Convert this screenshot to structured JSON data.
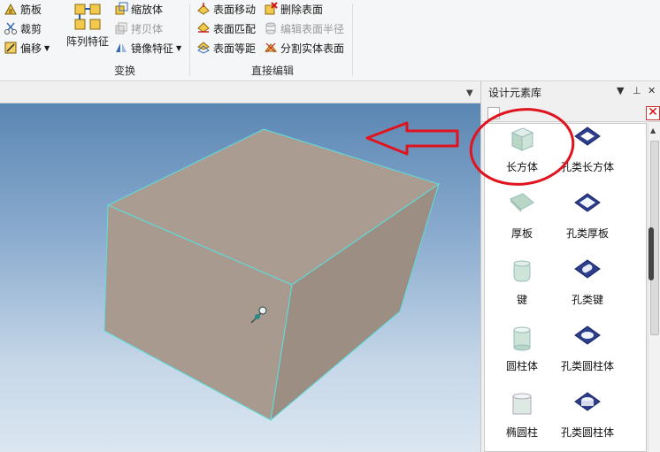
{
  "ribbon": {
    "col1": {
      "rib": "筋板",
      "trim": "裁剪",
      "offset": "偏移"
    },
    "big": {
      "pattern": "阵列特征"
    },
    "col2": {
      "scale": "缩放体",
      "copy": "拷贝体",
      "mirror": "镜像特征"
    },
    "transform_group": "变换",
    "col3": {
      "move": "表面移动",
      "match": "表面匹配",
      "equidist": "表面等距"
    },
    "col4": {
      "delete": "删除表面",
      "edit_radius": "编辑表面半径",
      "split": "分割实体表面"
    },
    "direct_edit_group": "直接编辑"
  },
  "panel": {
    "title": "设计元素库",
    "items": [
      {
        "label": "长方体",
        "icon": "box-icon"
      },
      {
        "label": "孔类长方体",
        "icon": "hole-box-icon"
      },
      {
        "label": "厚板",
        "icon": "thick-plate-icon"
      },
      {
        "label": "孔类厚板",
        "icon": "hole-plate-icon"
      },
      {
        "label": "键",
        "icon": "key-icon"
      },
      {
        "label": "孔类键",
        "icon": "hole-key-icon"
      },
      {
        "label": "圆柱体",
        "icon": "cylinder-icon"
      },
      {
        "label": "孔类圆柱体",
        "icon": "hole-cylinder-icon"
      },
      {
        "label": "椭圆柱",
        "icon": "elliptic-cylinder-icon"
      },
      {
        "label": "孔类圆柱体",
        "icon": "hole-cylinder-icon"
      }
    ]
  },
  "colors": {
    "annotation_red": "#e0141e",
    "box_face": "#a89a8e",
    "box_edge": "#59e0e0"
  }
}
